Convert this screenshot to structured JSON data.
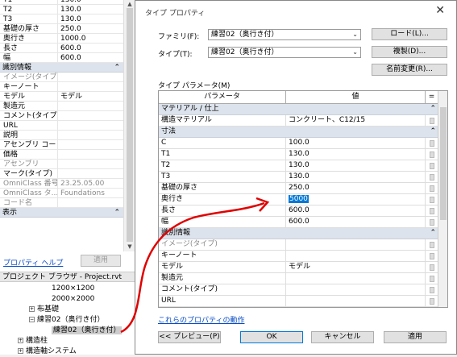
{
  "left_panel": {
    "rows_top": [
      {
        "name": "T1",
        "value": "130.0"
      },
      {
        "name": "T2",
        "value": "130.0"
      },
      {
        "name": "T3",
        "value": "130.0"
      },
      {
        "name": "基礎の厚さ",
        "value": "250.0"
      },
      {
        "name": "奥行き",
        "value": "1000.0"
      },
      {
        "name": "長さ",
        "value": "600.0"
      },
      {
        "name": "幅",
        "value": "600.0"
      }
    ],
    "section_identity": "識別情報",
    "rows_identity": [
      {
        "name": "イメージ(タイプ)",
        "value": "",
        "grey": true
      },
      {
        "name": "キーノート",
        "value": ""
      },
      {
        "name": "モデル",
        "value": "モデル"
      },
      {
        "name": "製造元",
        "value": ""
      },
      {
        "name": "コメント(タイプ)",
        "value": ""
      },
      {
        "name": "URL",
        "value": ""
      },
      {
        "name": "説明",
        "value": ""
      },
      {
        "name": "アセンブリ コード",
        "value": ""
      },
      {
        "name": "価格",
        "value": ""
      },
      {
        "name": "アセンブリ",
        "value": "",
        "grey": true
      },
      {
        "name": "マーク(タイプ)",
        "value": ""
      },
      {
        "name": "OmniClass 番号",
        "value": "23.25.05.00",
        "grey": true
      },
      {
        "name": "OmniClass タ...",
        "value": "Foundations",
        "grey": true
      },
      {
        "name": "コード名",
        "value": "",
        "grey": true
      }
    ],
    "section_display": "表示",
    "help_link": "プロパティ ヘルプ",
    "apply": "適用",
    "browser_title": "プロジェクト ブラウザ - Project.rvt",
    "tree": [
      {
        "label": "1200×1200",
        "indent": 64,
        "box": ""
      },
      {
        "label": "2000×2000",
        "indent": 64,
        "box": ""
      },
      {
        "label": "布基礎",
        "indent": 36,
        "box": "+"
      },
      {
        "label": "練習02（奥行き付）",
        "indent": 36,
        "box": "−"
      },
      {
        "label": "練習02（奥行き付）",
        "indent": 64,
        "box": "",
        "selected": true
      },
      {
        "label": "構造柱",
        "indent": 22,
        "box": "+"
      },
      {
        "label": "構造軸システム",
        "indent": 22,
        "box": "+"
      }
    ]
  },
  "dialog": {
    "title": "タイプ プロパティ",
    "close": "✕",
    "family_label": "ファミリ(F):",
    "family_value": "練習02（奥行き付）",
    "type_label": "タイプ(T):",
    "type_value": "練習02（奥行き付）",
    "load_btn": "ロード(L)...",
    "duplicate_btn": "複製(D)...",
    "rename_btn": "名前変更(R)...",
    "type_params_label": "タイプ パラメータ(M)",
    "col_param": "パラメータ",
    "col_value": "値",
    "col_eq": "=",
    "sections": [
      {
        "title": "マテリアル / 仕上",
        "rows": [
          {
            "name": "構造マテリアル",
            "value": "コンクリート、C12/15"
          }
        ]
      },
      {
        "title": "寸法",
        "rows": [
          {
            "name": "C",
            "value": "100.0"
          },
          {
            "name": "T1",
            "value": "130.0"
          },
          {
            "name": "T2",
            "value": "130.0"
          },
          {
            "name": "T3",
            "value": "130.0"
          },
          {
            "name": "基礎の厚さ",
            "value": "250.0"
          },
          {
            "name": "奥行き",
            "value": "5000",
            "selected": true
          },
          {
            "name": "長さ",
            "value": "600.0"
          },
          {
            "name": "幅",
            "value": "600.0"
          }
        ]
      },
      {
        "title": "識別情報",
        "rows": [
          {
            "name": "イメージ(タイプ)",
            "value": "",
            "grey": true
          },
          {
            "name": "キーノート",
            "value": ""
          },
          {
            "name": "モデル",
            "value": "モデル"
          },
          {
            "name": "製造元",
            "value": ""
          },
          {
            "name": "コメント(タイプ)",
            "value": ""
          },
          {
            "name": "URL",
            "value": ""
          }
        ]
      }
    ],
    "prop_link": "これらのプロパティの動作",
    "preview_btn": "<< プレビュー(P)",
    "ok_btn": "OK",
    "cancel_btn": "キャンセル",
    "apply_btn": "適用"
  },
  "colors": {
    "annotation_arrow": "#e00000",
    "selection": "#0078d7",
    "section_bg": "#dde3ec"
  }
}
